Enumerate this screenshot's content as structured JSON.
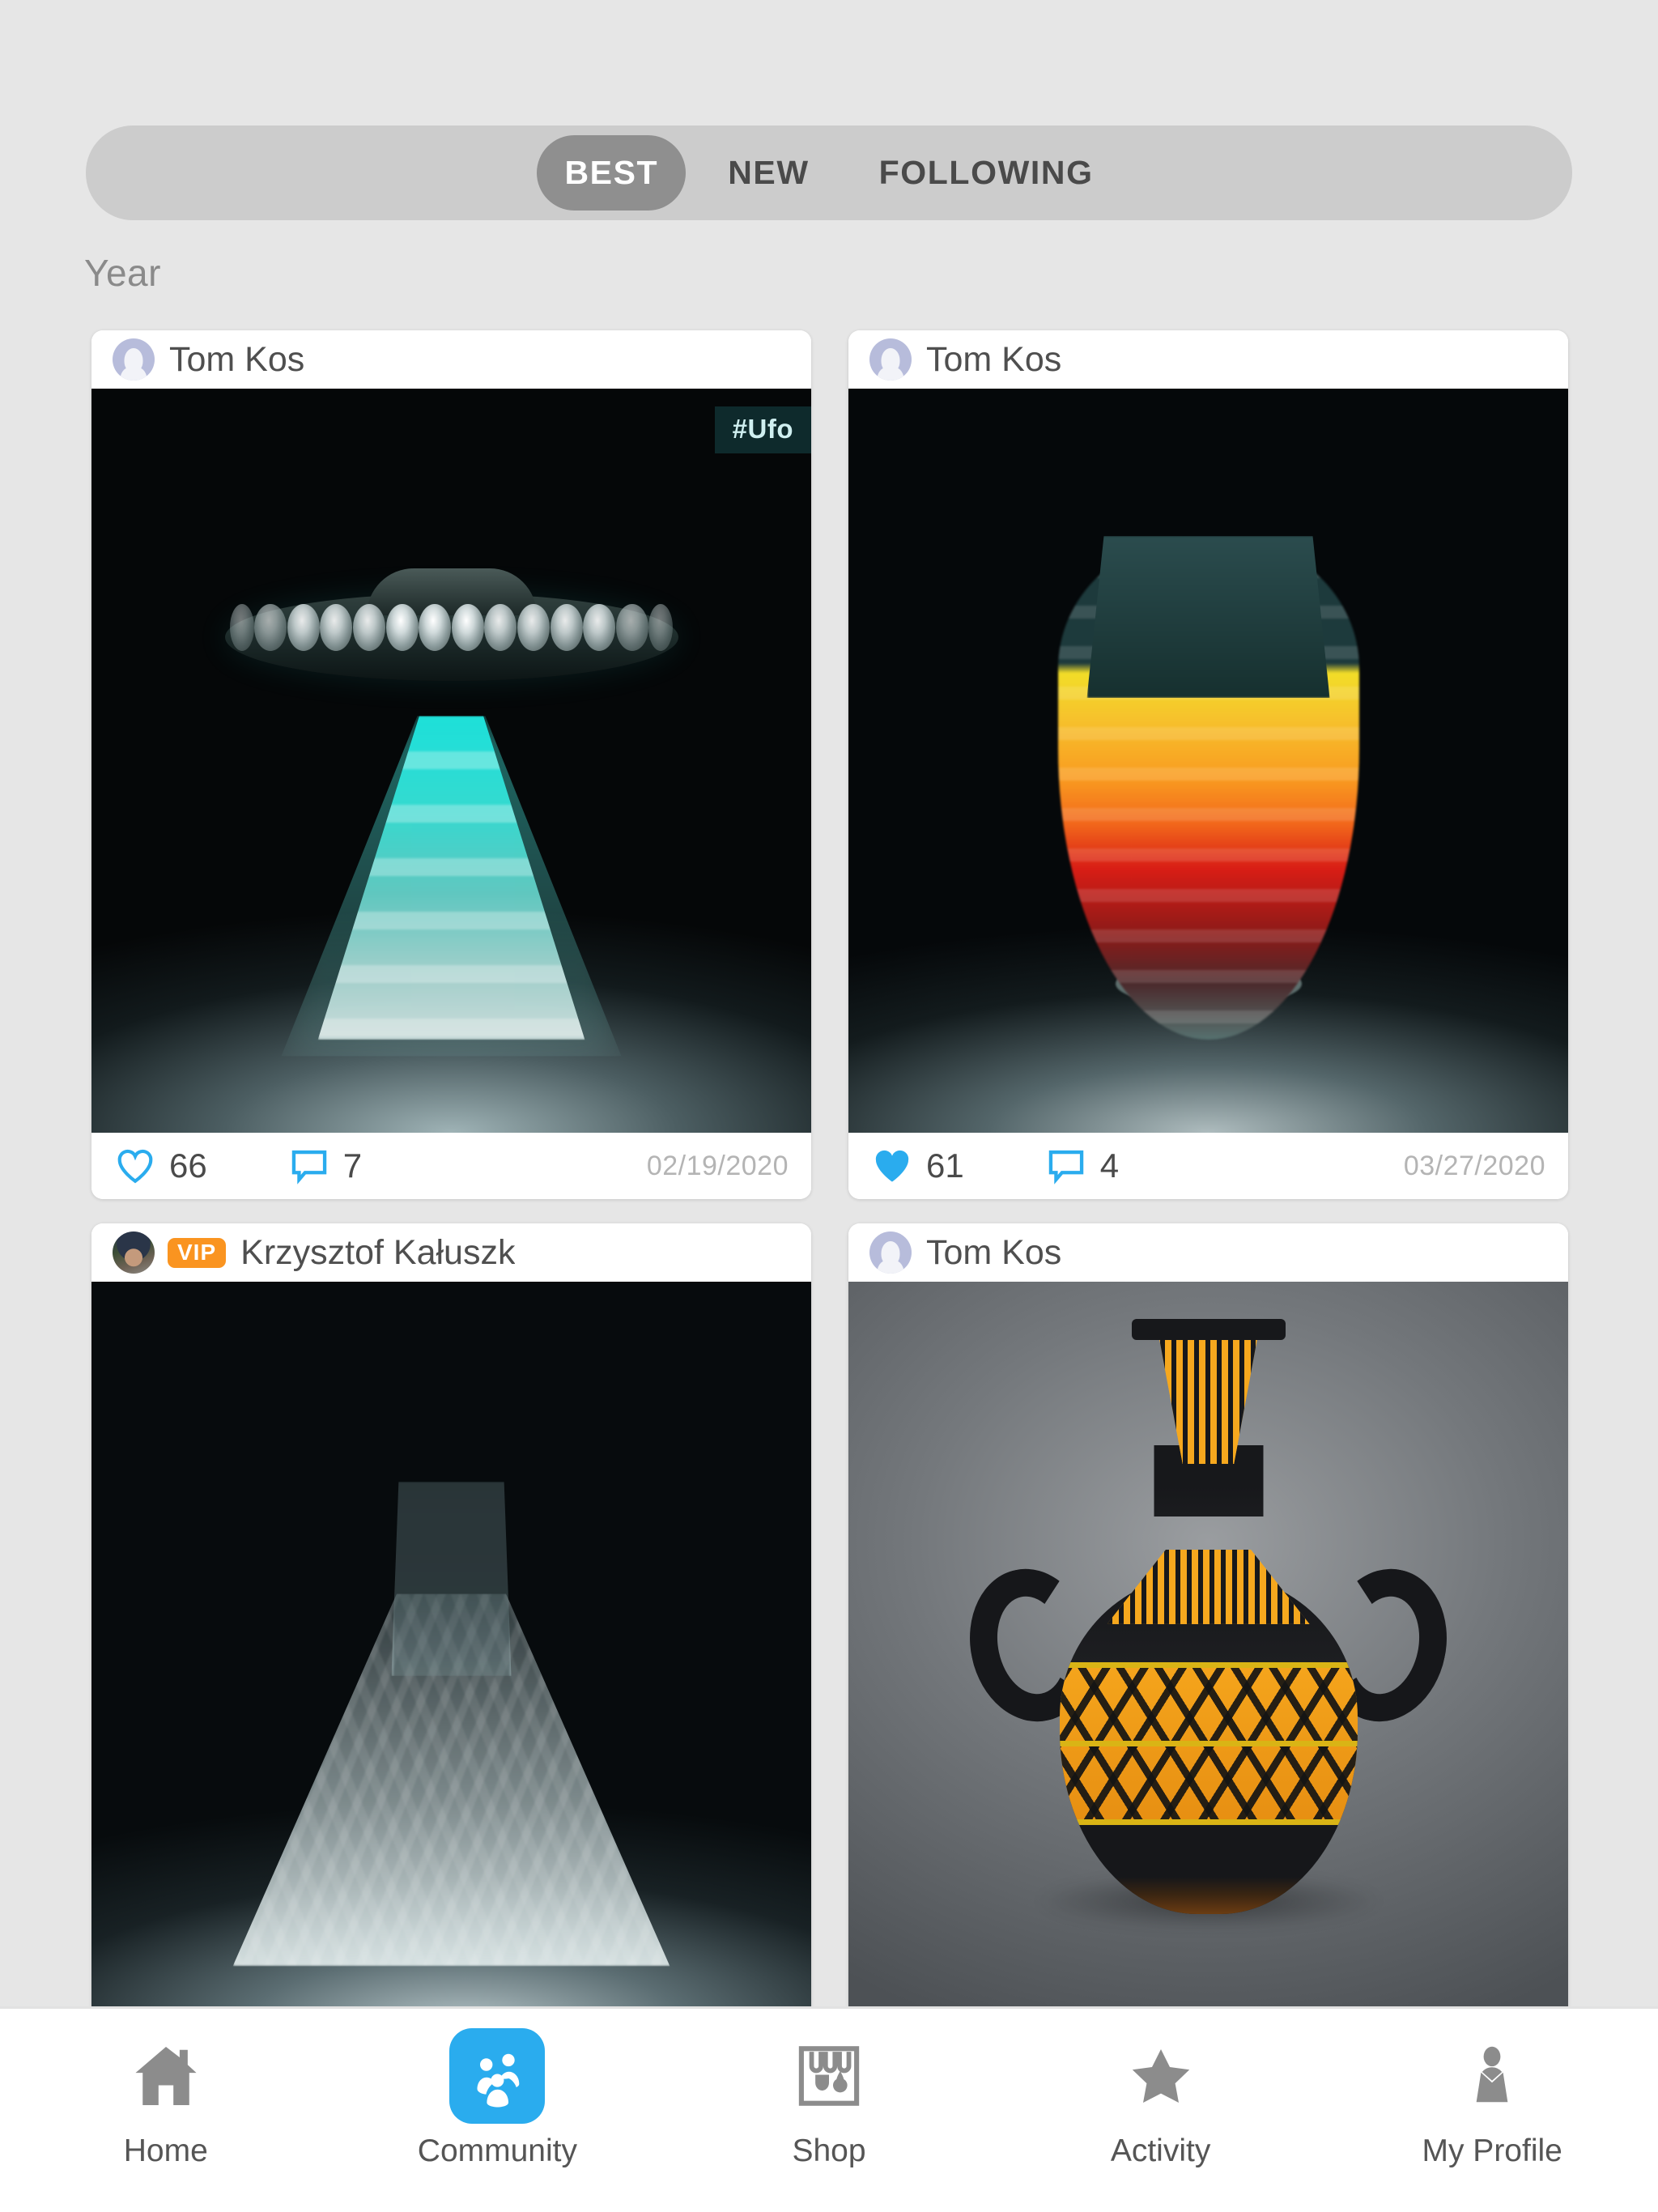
{
  "segmented_control": {
    "name": "feed-sort-tabs",
    "options": [
      {
        "label": "BEST",
        "active": true
      },
      {
        "label": "NEW",
        "active": false
      },
      {
        "label": "FOLLOWING",
        "active": false
      }
    ]
  },
  "period": {
    "label": "Year"
  },
  "colors": {
    "accent_blue": "#2aacee",
    "vip_orange": "#fa9420",
    "tag_bg": "#0e2a2c",
    "tag_text": "#cfeff0",
    "page_bg": "#e6e6e6",
    "segment_bg": "#cccccc",
    "segment_active_bg": "#8f8f8f"
  },
  "posts": [
    {
      "author": "Tom Kos",
      "avatar": "generic-avatar-icon",
      "vip": false,
      "tag": "#Ufo",
      "artwork": "ufo-lamp-render",
      "likes": "66",
      "liked": false,
      "comments": "7",
      "date": "02/19/2020"
    },
    {
      "author": "Tom Kos",
      "avatar": "generic-avatar-icon",
      "vip": false,
      "tag": null,
      "artwork": "warm-gradient-goblet-render",
      "likes": "61",
      "liked": true,
      "comments": "4",
      "date": "03/27/2020"
    },
    {
      "author": "Krzysztof Kałuszk",
      "avatar": "photo-avatar",
      "vip": true,
      "vip_label": "VIP",
      "tag": null,
      "artwork": "clear-textured-cone-vase-render",
      "likes": null,
      "liked": false,
      "comments": null,
      "date": null
    },
    {
      "author": "Tom Kos",
      "avatar": "generic-avatar-icon",
      "vip": false,
      "tag": null,
      "artwork": "black-gold-amphora-render",
      "likes": null,
      "liked": false,
      "comments": null,
      "date": null
    }
  ],
  "tabbar": {
    "items": [
      {
        "label": "Home",
        "icon": "house-icon",
        "active": false
      },
      {
        "label": "Community",
        "icon": "community-people-icon",
        "active": true
      },
      {
        "label": "Shop",
        "icon": "storefront-icon",
        "active": false
      },
      {
        "label": "Activity",
        "icon": "star-icon",
        "active": false
      },
      {
        "label": "My Profile",
        "icon": "person-bust-icon",
        "active": false
      }
    ]
  }
}
